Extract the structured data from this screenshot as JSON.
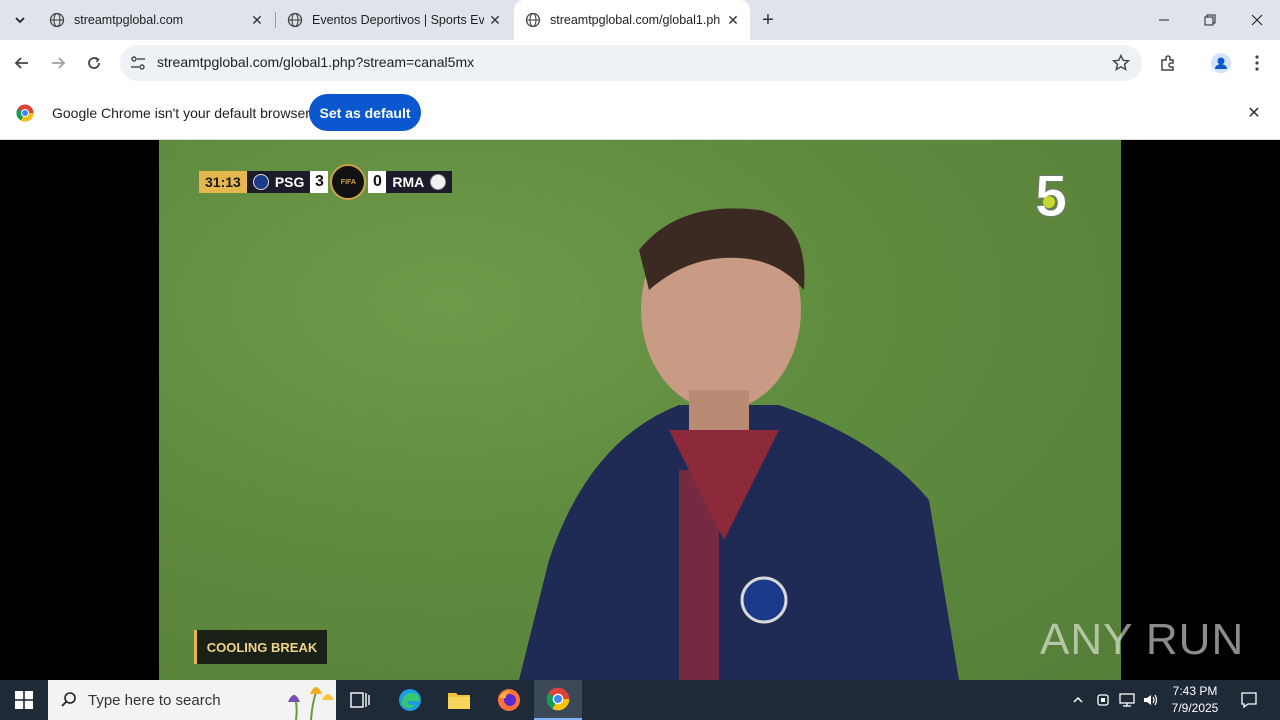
{
  "browser": {
    "tabs": [
      {
        "title": "streamtpglobal.com"
      },
      {
        "title": "Eventos Deportivos | Sports Eve"
      },
      {
        "title": "streamtpglobal.com/global1.ph"
      }
    ],
    "address": "streamtpglobal.com/global1.php?stream=canal5mx",
    "infobar_text": "Google Chrome isn't your default browser",
    "infobar_button": "Set as default"
  },
  "video": {
    "time": "31:13",
    "home_team": "PSG",
    "home_score": "3",
    "away_team": "RMA",
    "away_score": "0",
    "cup_label": "FIFA",
    "channel": "5",
    "overlay_caption": "COOLING BREAK",
    "watermark": "ANY RUN"
  },
  "taskbar": {
    "search_placeholder": "Type here to search",
    "time": "7:43 PM",
    "date": "7/9/2025"
  },
  "colors": {
    "tabstrip": "#dfe3eb",
    "accent_button": "#0b57d0",
    "taskbar": "#1e2a38",
    "pitch": "#5f8b3f"
  }
}
